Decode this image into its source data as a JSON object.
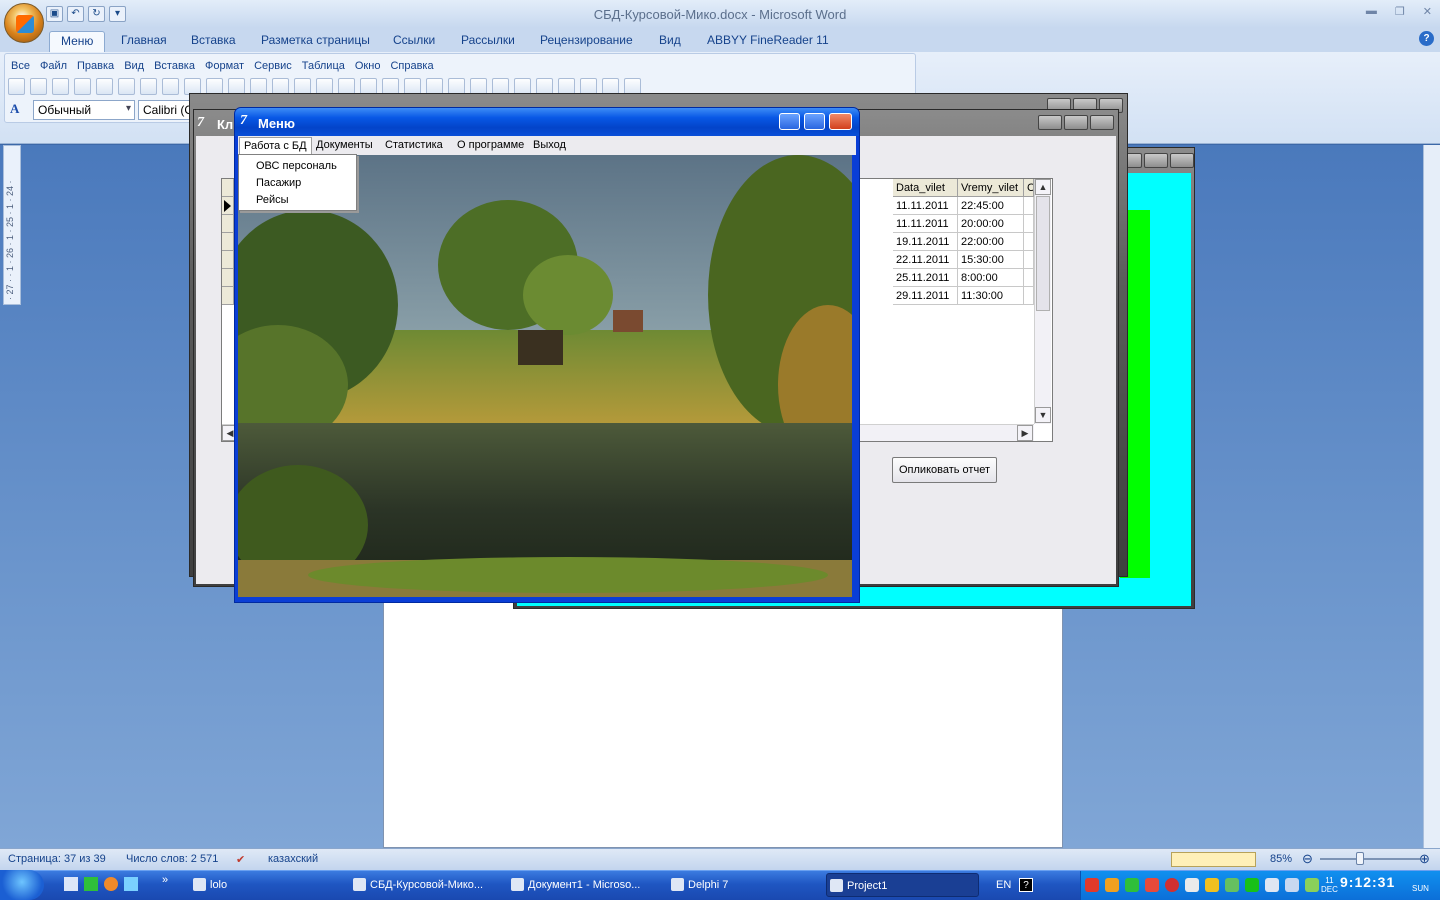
{
  "word": {
    "title": "СБД-Курсовой-Мико.docx - Microsoft Word",
    "tabs": [
      "Меню",
      "Главная",
      "Вставка",
      "Разметка страницы",
      "Ссылки",
      "Рассылки",
      "Рецензирование",
      "Вид",
      "ABBYY FineReader 11"
    ],
    "active_tab": "Меню",
    "classic_menu": [
      "Все",
      "Файл",
      "Правка",
      "Вид",
      "Вставка",
      "Формат",
      "Сервис",
      "Таблица",
      "Окно",
      "Справка"
    ],
    "style_value": "Обычный",
    "font_value": "Calibri (О",
    "ruler_marks": "· 27 · · 1 · 26 · 1 · 25 · 1 · 24 ·"
  },
  "status_bar": {
    "page": "Страница: 37 из 39",
    "words": "Число слов: 2 571",
    "language": "казахский",
    "zoom": "85%"
  },
  "delphi_back": {
    "title": "Кл"
  },
  "grid": {
    "columns": [
      "Data_vilet",
      "Vremy_vilet",
      "C"
    ],
    "rows": [
      [
        "11.11.2011",
        "22:45:00"
      ],
      [
        "11.11.2011",
        "20:00:00"
      ],
      [
        "19.11.2011",
        "22:00:00"
      ],
      [
        "22.11.2011",
        "15:30:00"
      ],
      [
        "25.11.2011",
        "8:00:00"
      ],
      [
        "29.11.2011",
        "11:30:00"
      ]
    ],
    "report_button": "Опликовать отчет"
  },
  "menu_window": {
    "title": "Меню",
    "menubar": [
      "Работа с БД",
      "Документы",
      "Статистика",
      "О программе",
      "Выход"
    ],
    "dropdown": [
      "ОВС персональ",
      "Пасажир",
      "Рейсы"
    ]
  },
  "taskbar": {
    "items": [
      "lolo",
      "СБД-Курсовой-Мико...",
      "Документ1 - Microso...",
      "Delphi 7",
      "Project1"
    ],
    "active": "Project1",
    "lang": "EN",
    "date_day": "11",
    "date_month": "DEC",
    "time": "9:12:31",
    "weekday": "SUN"
  }
}
